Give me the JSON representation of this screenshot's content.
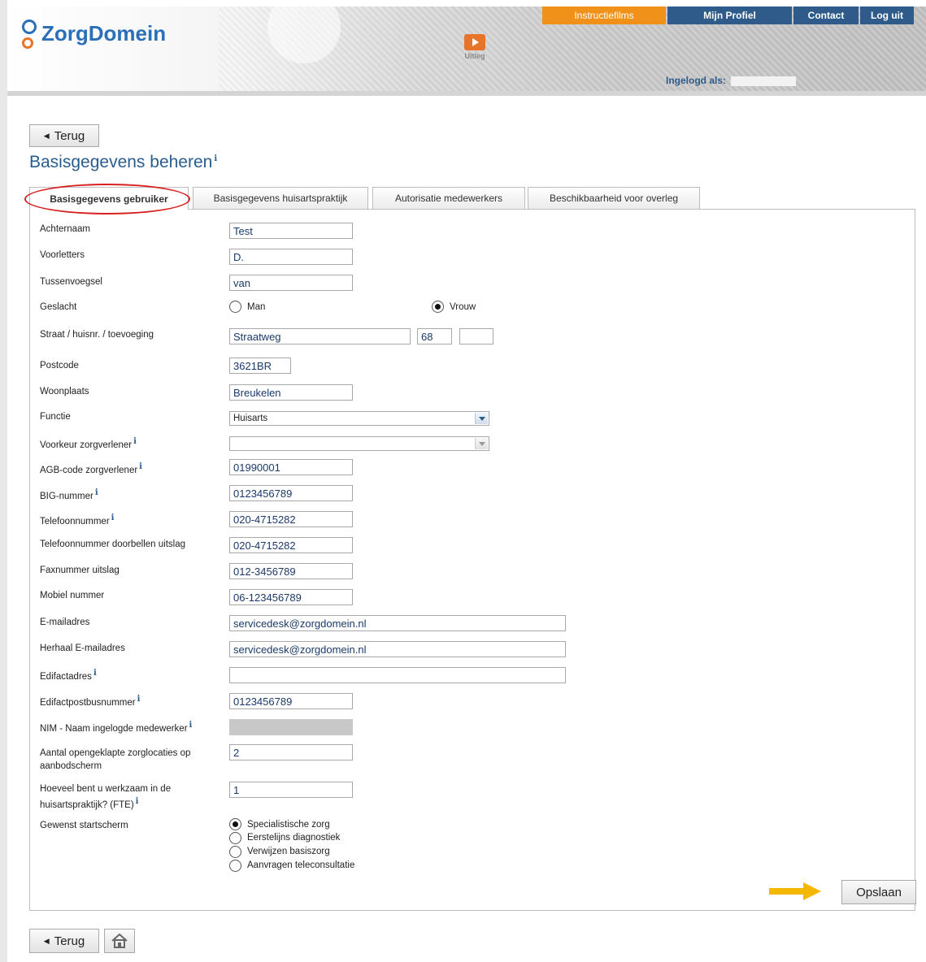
{
  "header": {
    "logo_text": "ZorgDomein",
    "uitleg_label": "Uitleg",
    "nav": {
      "instructiefilms": "Instructiefilms",
      "mijn_profiel": "Mijn Profiel",
      "contact": "Contact",
      "log_uit": "Log uit"
    },
    "ingelogd_als": "Ingelogd als:"
  },
  "back_button": "Terug",
  "page_title": "Basisgegevens beheren",
  "info_glyph": "i",
  "tabs": [
    {
      "label": "Basisgegevens gebruiker",
      "active": true
    },
    {
      "label": "Basisgegevens huisartspraktijk",
      "active": false
    },
    {
      "label": "Autorisatie medewerkers",
      "active": false
    },
    {
      "label": "Beschikbaarheid voor overleg",
      "active": false
    }
  ],
  "form": {
    "achternaam": {
      "label": "Achternaam",
      "value": "Test"
    },
    "voorletters": {
      "label": "Voorletters",
      "value": "D."
    },
    "tussenvoegsel": {
      "label": "Tussenvoegsel",
      "value": "van"
    },
    "geslacht": {
      "label": "Geslacht",
      "options": [
        "Man",
        "Vrouw"
      ],
      "selected": "Vrouw"
    },
    "adres": {
      "label": "Straat / huisnr. / toevoeging",
      "straat": "Straatweg",
      "huisnr": "68",
      "toevoeging": ""
    },
    "postcode": {
      "label": "Postcode",
      "value": "3621BR"
    },
    "woonplaats": {
      "label": "Woonplaats",
      "value": "Breukelen"
    },
    "functie": {
      "label": "Functie",
      "value": "Huisarts"
    },
    "voorkeur": {
      "label": "Voorkeur zorgverlener",
      "value": ""
    },
    "agb": {
      "label": "AGB-code zorgverlener",
      "value": "01990001"
    },
    "big": {
      "label": "BIG-nummer",
      "value": "0123456789"
    },
    "telefoon": {
      "label": "Telefoonnummer",
      "value": "020-4715282"
    },
    "telefoon_doorbellen": {
      "label": "Telefoonnummer doorbellen uitslag",
      "value": "020-4715282"
    },
    "fax": {
      "label": "Faxnummer uitslag",
      "value": "012-3456789"
    },
    "mobiel": {
      "label": "Mobiel nummer",
      "value": "06-123456789"
    },
    "email": {
      "label": "E-mailadres",
      "value": "servicedesk@zorgdomein.nl"
    },
    "email_herhaal": {
      "label": "Herhaal E-mailadres",
      "value": "servicedesk@zorgdomein.nl"
    },
    "edifact": {
      "label": "Edifactadres",
      "value": ""
    },
    "edifact_postbus": {
      "label": "Edifactpostbusnummer",
      "value": "0123456789"
    },
    "nim": {
      "label": "NIM - Naam ingelogde medewerker",
      "value": ""
    },
    "aantal_zorglocaties": {
      "label_line1": "Aantal opengeklapte zorglocaties op",
      "label_line2": "aanbodscherm",
      "value": "2"
    },
    "fte": {
      "label_line1": "Hoeveel bent u werkzaam in de",
      "label_line2": "huisartspraktijk? (FTE)",
      "value": "1"
    },
    "startscherm": {
      "label": "Gewenst startscherm",
      "options": [
        "Specialistische zorg",
        "Eerstelijns diagnostiek",
        "Verwijzen basiszorg",
        "Aanvragen teleconsultatie"
      ],
      "selected": "Specialistische zorg"
    }
  },
  "save_button": "Opslaan",
  "colors": {
    "accent_orange": "#f0911a",
    "nav_blue": "#2f5b8a",
    "title_blue": "#2a5d8f",
    "highlight_red": "#d92020",
    "arrow_yellow": "#f5b800"
  }
}
